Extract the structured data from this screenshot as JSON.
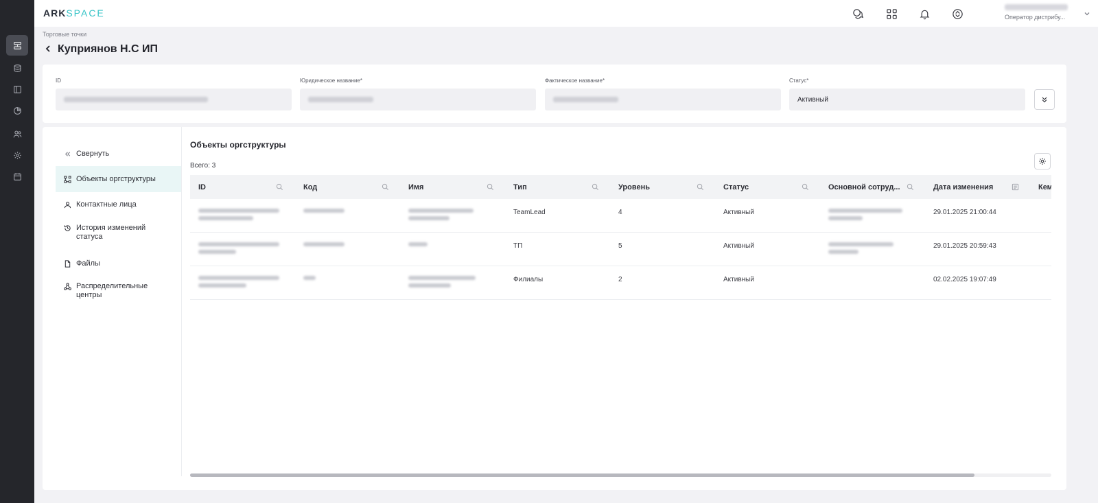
{
  "app": {
    "logo_ark": "ARK",
    "logo_space": "SPACE"
  },
  "rail": {
    "icons": [
      "org-structure-icon",
      "database-icon",
      "layout-icon",
      "pie-chart-icon",
      "users-icon",
      "settings-icon",
      "calendar-icon"
    ]
  },
  "topbar": {
    "icons": [
      "chat-icon",
      "apps-grid-icon",
      "bell-icon",
      "sync-icon"
    ],
    "user_role": "Оператор дистрибу..."
  },
  "breadcrumb": "Торговые точки",
  "page_title": "Куприянов Н.С ИП",
  "fields": {
    "id_label": "ID",
    "legal_name_label": "Юридическое название*",
    "actual_name_label": "Фактическое название*",
    "status_label": "Статус*",
    "status_value": "Активный"
  },
  "side_nav": {
    "collapse": "Свернуть",
    "items": [
      {
        "label": "Объекты оргструктуры",
        "icon": "org-structure-icon",
        "active": true
      },
      {
        "label": "Контактные лица",
        "icon": "user-icon",
        "active": false
      },
      {
        "label": "История изменений статуса",
        "icon": "history-icon",
        "active": false
      },
      {
        "label": "Файлы",
        "icon": "file-icon",
        "active": false
      },
      {
        "label": "Распределительные центры",
        "icon": "network-icon",
        "active": false
      }
    ]
  },
  "section": {
    "title": "Объекты оргструктуры",
    "total": "Всего: 3"
  },
  "table": {
    "columns": [
      "ID",
      "Код",
      "Имя",
      "Тип",
      "Уровень",
      "Статус",
      "Основной сотруд...",
      "Дата изменения",
      "Кем"
    ],
    "rows": [
      {
        "type": "TeamLead",
        "level": "4",
        "status": "Активный",
        "date": "29.01.2025 21:00:44"
      },
      {
        "type": "ТП",
        "level": "5",
        "status": "Активный",
        "date": "29.01.2025 20:59:43"
      },
      {
        "type": "Филиалы",
        "level": "2",
        "status": "Активный",
        "date": "02.02.2025 19:07:49"
      }
    ]
  },
  "colors": {
    "accent": "#38c4c7",
    "rail_bg": "#25262b",
    "active_nav_bg": "#e9f6f6"
  }
}
